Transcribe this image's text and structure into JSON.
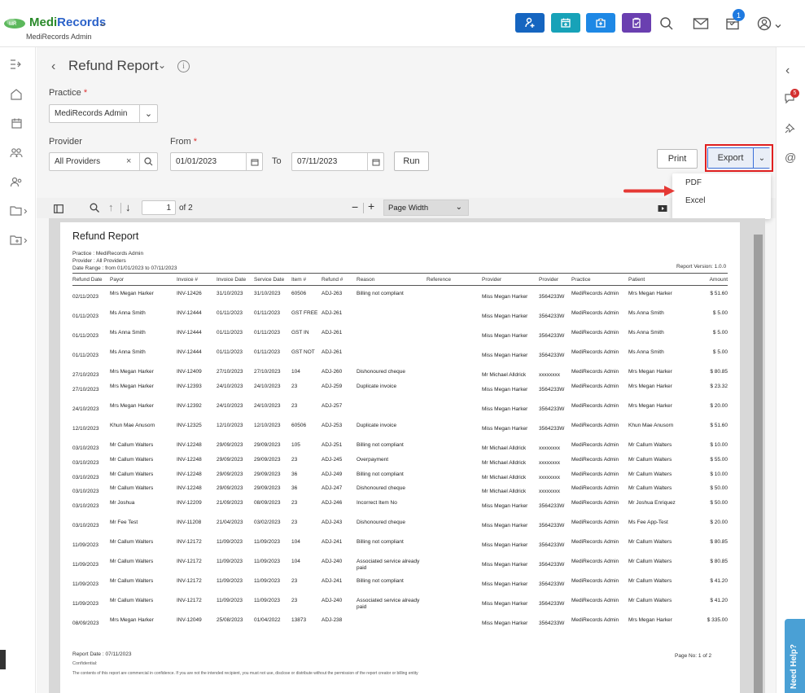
{
  "app": {
    "brand_part1": "Medi",
    "brand_part2": "Records",
    "subtitle": "MediRecords Admin",
    "notification_count": "1"
  },
  "page": {
    "title": "Refund Report"
  },
  "filters": {
    "practice_label": "Practice",
    "practice_value": "MediRecords Admin",
    "provider_label": "Provider",
    "provider_value": "All Providers",
    "from_label": "From",
    "from_value": "01/01/2023",
    "to_label": "To",
    "to_value": "07/11/2023",
    "run": "Run",
    "print": "Print",
    "export": "Export",
    "export_options": [
      "PDF",
      "Excel"
    ]
  },
  "viewer": {
    "page_input": "1",
    "page_of": "of 2",
    "zoom": "Page Width"
  },
  "rightnav": {
    "chat_badge": "5"
  },
  "help": "Need Help?",
  "report": {
    "title": "Refund Report",
    "practice_line": "Practice : MediRecords Admin",
    "provider_line": "Provider : All Providers",
    "date_range_line": "Date Range : from 01/01/2023 to 07/11/2023",
    "version": "Report Version: 1.0.0",
    "columns": [
      "Refund Date",
      "Payor",
      "Invoice #",
      "Invoice Date",
      "Service Date",
      "Item #",
      "Refund #",
      "Reason",
      "Reference",
      "Provider",
      "Provider",
      "Practice",
      "Patient",
      "Amount"
    ],
    "rows": [
      [
        "02/11/2023",
        "Mrs Megan Harker",
        "INV-12426",
        "31/10/2023",
        "31/10/2023",
        "60506",
        "ADJ-263",
        "Billing not compliant",
        "",
        "Miss Megan Harker",
        "3564233W",
        "MediRecords Admin",
        "Mrs Megan Harker",
        "$ 51.60"
      ],
      [
        "01/11/2023",
        "Ms Anna Smith",
        "INV-12444",
        "01/11/2023",
        "01/11/2023",
        "GST FREE",
        "ADJ-261",
        "",
        "",
        "Miss Megan Harker",
        "3564233W",
        "MediRecords Admin",
        "Ms Anna Smith",
        "$ 5.00"
      ],
      [
        "01/11/2023",
        "Ms Anna Smith",
        "INV-12444",
        "01/11/2023",
        "01/11/2023",
        "GST IN",
        "ADJ-261",
        "",
        "",
        "Miss Megan Harker",
        "3564233W",
        "MediRecords Admin",
        "Ms Anna Smith",
        "$ 5.00"
      ],
      [
        "01/11/2023",
        "Ms Anna Smith",
        "INV-12444",
        "01/11/2023",
        "01/11/2023",
        "GST NOT",
        "ADJ-261",
        "",
        "",
        "Miss Megan Harker",
        "3564233W",
        "MediRecords Admin",
        "Ms Anna Smith",
        "$ 5.00"
      ],
      [
        "27/10/2023",
        "Mrs Megan Harker",
        "INV-12409",
        "27/10/2023",
        "27/10/2023",
        "104",
        "ADJ-260",
        "Dishonoured cheque",
        "",
        "Mr Michael Alldrick",
        "xxxxxxxx",
        "MediRecords Admin",
        "Mrs Megan Harker",
        "$ 80.85"
      ],
      [
        "27/10/2023",
        "Mrs Megan Harker",
        "INV-12393",
        "24/10/2023",
        "24/10/2023",
        "23",
        "ADJ-259",
        "Duplicate invoice",
        "",
        "Miss Megan Harker",
        "3564233W",
        "MediRecords Admin",
        "Mrs Megan Harker",
        "$ 23.32"
      ],
      [
        "24/10/2023",
        "Mrs Megan Harker",
        "INV-12392",
        "24/10/2023",
        "24/10/2023",
        "23",
        "ADJ-257",
        "",
        "",
        "Miss Megan Harker",
        "3564233W",
        "MediRecords Admin",
        "Mrs Megan Harker",
        "$ 20.00"
      ],
      [
        "12/10/2023",
        "Khun Mae Anusorn",
        "INV-12325",
        "12/10/2023",
        "12/10/2023",
        "60506",
        "ADJ-253",
        "Duplicate invoice",
        "",
        "Miss Megan Harker",
        "3564233W",
        "MediRecords Admin",
        "Khun Mae Anusorn",
        "$ 51.60"
      ],
      [
        "03/10/2023",
        "Mr Callum Walters",
        "INV-12248",
        "29/09/2023",
        "29/09/2023",
        "105",
        "ADJ-251",
        "Billing not compliant",
        "",
        "Mr Michael Alldrick",
        "xxxxxxxx",
        "MediRecords Admin",
        "Mr Callum Walters",
        "$ 10.00"
      ],
      [
        "03/10/2023",
        "Mr Callum Walters",
        "INV-12248",
        "29/09/2023",
        "29/09/2023",
        "23",
        "ADJ-245",
        "Overpayment",
        "",
        "Mr Michael Alldrick",
        "xxxxxxxx",
        "MediRecords Admin",
        "Mr Callum Walters",
        "$ 55.00"
      ],
      [
        "03/10/2023",
        "Mr Callum Walters",
        "INV-12248",
        "29/09/2023",
        "29/09/2023",
        "36",
        "ADJ-249",
        "Billing not compliant",
        "",
        "Mr Michael Alldrick",
        "xxxxxxxx",
        "MediRecords Admin",
        "Mr Callum Walters",
        "$ 10.00"
      ],
      [
        "03/10/2023",
        "Mr Callum Walters",
        "INV-12248",
        "29/09/2023",
        "29/09/2023",
        "36",
        "ADJ-247",
        "Dishonoured cheque",
        "",
        "Mr Michael Alldrick",
        "xxxxxxxx",
        "MediRecords Admin",
        "Mr Callum Walters",
        "$ 50.00"
      ],
      [
        "03/10/2023",
        "Mr Joshua",
        "INV-12209",
        "21/09/2023",
        "08/09/2023",
        "23",
        "ADJ-246",
        "Incorrect Item No",
        "",
        "Miss Megan Harker",
        "3564233W",
        "MediRecords Admin",
        "Mr Joshua Enriquez",
        "$ 50.00"
      ],
      [
        "03/10/2023",
        "Mr Fee Test",
        "INV-11208",
        "21/04/2023",
        "03/02/2023",
        "23",
        "ADJ-243",
        "Dishonoured cheque",
        "",
        "Miss Megan Harker",
        "3564233W",
        "MediRecords Admin",
        "Ms Fee App-Test",
        "$ 20.00"
      ],
      [
        "11/09/2023",
        "Mr Callum Walters",
        "INV-12172",
        "11/09/2023",
        "11/09/2023",
        "104",
        "ADJ-241",
        "Billing not compliant",
        "",
        "Miss Megan Harker",
        "3564233W",
        "MediRecords Admin",
        "Mr Callum Walters",
        "$ 80.85"
      ],
      [
        "11/09/2023",
        "Mr Callum Walters",
        "INV-12172",
        "11/09/2023",
        "11/09/2023",
        "104",
        "ADJ-240",
        "Associated service already paid",
        "",
        "Miss Megan Harker",
        "3564233W",
        "MediRecords Admin",
        "Mr Callum Walters",
        "$ 80.85"
      ],
      [
        "11/09/2023",
        "Mr Callum Walters",
        "INV-12172",
        "11/09/2023",
        "11/09/2023",
        "23",
        "ADJ-241",
        "Billing not compliant",
        "",
        "Miss Megan Harker",
        "3564233W",
        "MediRecords Admin",
        "Mr Callum Walters",
        "$ 41.20"
      ],
      [
        "11/09/2023",
        "Mr Callum Walters",
        "INV-12172",
        "11/09/2023",
        "11/09/2023",
        "23",
        "ADJ-240",
        "Associated service already paid",
        "",
        "Miss Megan Harker",
        "3564233W",
        "MediRecords Admin",
        "Mr Callum Walters",
        "$ 41.20"
      ],
      [
        "08/09/2023",
        "Mrs Megan Harker",
        "INV-12049",
        "25/08/2023",
        "01/04/2022",
        "13873",
        "ADJ-238",
        "",
        "",
        "Miss Megan Harker",
        "3564233W",
        "MediRecords Admin",
        "Mrs Megan Harker",
        "$ 335.00"
      ]
    ],
    "report_date": "Report Date : 07/11/2023",
    "confidential": "Confidential:",
    "disclaimer": "The contents of this report are commercial in confidence. If you are not the intended recipient, you must not use, disclose or distribute without the permission of the report creator or billing entity",
    "page_no": "Page No: 1 of 2"
  },
  "colors": {
    "accent": "#2b62c9",
    "export_highlight": "#e02020",
    "btn_blue": "#1565c0",
    "btn_teal": "#17a2b8",
    "btn_blue2": "#1e88e5",
    "btn_purple": "#6a3fb0"
  }
}
